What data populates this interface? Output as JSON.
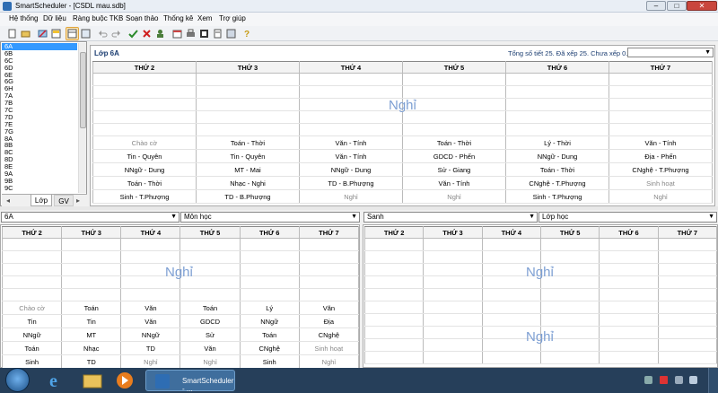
{
  "window": {
    "title": "SmartScheduler - [CSDL mau.sdb]",
    "min": "–",
    "max": "□",
    "close": "✕"
  },
  "menu": [
    "Hệ thống",
    "Dữ liệu",
    "Ràng buộc TKB",
    "Soạn thảo",
    "Thống kê",
    "Xem",
    "Trợ giúp"
  ],
  "classes": [
    "6A",
    "6B",
    "6C",
    "6D",
    "6E",
    "6G",
    "6H",
    "7A",
    "7B",
    "7C",
    "7D",
    "7E",
    "7G",
    "8A",
    "8B",
    "8C",
    "8D",
    "8E",
    "9A",
    "9B",
    "9C"
  ],
  "selected_class": "6A",
  "left_tabs": {
    "lop": "Lớp",
    "gv": "GV"
  },
  "top_grid": {
    "title": "Lớp 6A",
    "summary": "Tổng số tiết 25. Đã xếp 25. Chưa xếp 0.",
    "days": [
      "THỨ 2",
      "THỨ 3",
      "THỨ 4",
      "THỨ 5",
      "THỨ 6",
      "THỨ 7"
    ],
    "nghi": "Nghỉ",
    "rows": [
      [
        "Chào cờ",
        "Toán - Thời",
        "Văn - Tính",
        "Toán - Thời",
        "Lý - Thời",
        "Văn - Tính"
      ],
      [
        "Tin - Quyên",
        "Tin - Quyên",
        "Văn - Tính",
        "GDCD - Phến",
        "NNgữ - Dung",
        "Địa - Phến"
      ],
      [
        "NNgữ - Dung",
        "MT - Mai",
        "NNgữ - Dung",
        "Sử - Giang",
        "Toán - Thời",
        "CNghệ - T.Phượng"
      ],
      [
        "Toán - Thời",
        "Nhạc - Nghi",
        "TD - B.Phượng",
        "Văn - Tính",
        "CNghệ - T.Phượng",
        "Sinh hoạt"
      ],
      [
        "Sinh - T.Phượng",
        "TD - B.Phượng",
        "Nghỉ",
        "Nghỉ",
        "Sinh - T.Phượng",
        "Nghỉ"
      ]
    ]
  },
  "bottom_left": {
    "class_select": "6A",
    "subject_select": "Môn học",
    "days": [
      "THỨ 2",
      "THỨ 3",
      "THỨ 4",
      "THỨ 5",
      "THỨ 6",
      "THỨ 7"
    ],
    "nghi": "Nghỉ",
    "rows": [
      [
        "Chào cờ",
        "Toán",
        "Văn",
        "Toán",
        "Lý",
        "Văn"
      ],
      [
        "Tin",
        "Tin",
        "Văn",
        "GDCD",
        "NNgữ",
        "Địa"
      ],
      [
        "NNgữ",
        "MT",
        "NNgữ",
        "Sử",
        "Toán",
        "CNghệ"
      ],
      [
        "Toán",
        "Nhạc",
        "TD",
        "Văn",
        "CNghệ",
        "Sinh hoạt"
      ],
      [
        "Sinh",
        "TD",
        "Nghỉ",
        "Nghỉ",
        "Sinh",
        "Nghỉ"
      ]
    ]
  },
  "bottom_right": {
    "subject_select": "Sanh",
    "class_select": "Lớp học",
    "days": [
      "THỨ 2",
      "THỨ 3",
      "THỨ 4",
      "THỨ 5",
      "THỨ 6",
      "THỨ 7"
    ],
    "nghi_top": "Nghỉ",
    "nghi_bottom": "Nghỉ"
  },
  "taskbar": {
    "active_app": "SmartScheduler - ..."
  }
}
